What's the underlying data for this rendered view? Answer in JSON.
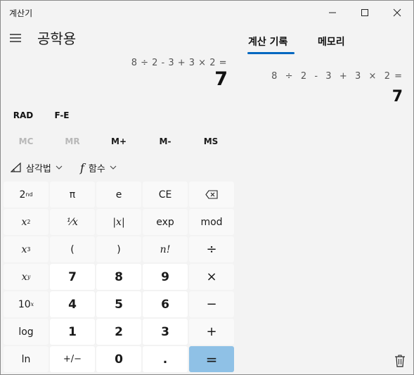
{
  "window": {
    "title": "계산기"
  },
  "header": {
    "mode_title": "공학용"
  },
  "display": {
    "expression": "8 ÷ 2 - 3 + 3 × 2 =",
    "result": "7"
  },
  "modes": {
    "angle": "RAD",
    "fe": "F-E"
  },
  "memory": {
    "mc": "MC",
    "mr": "MR",
    "mplus": "M+",
    "mminus": "M-",
    "ms": "MS"
  },
  "dropdowns": {
    "trig": "삼각법",
    "func_symbol": "f",
    "func": "함수"
  },
  "keypad": {
    "second": "2",
    "second_sup": "nd",
    "pi": "π",
    "e": "e",
    "ce": "CE",
    "x": "x",
    "sq_sup": "2",
    "reciprocal": "⅟x",
    "abs": "|x|",
    "exp": "exp",
    "mod": "mod",
    "cube_sup": "3",
    "lparen": "(",
    "rparen": ")",
    "fact": "n!",
    "divide": "÷",
    "pow_sup": "y",
    "n7": "7",
    "n8": "8",
    "n9": "9",
    "multiply": "×",
    "ten": "10",
    "ten_sup": "x",
    "n4": "4",
    "n5": "5",
    "n6": "6",
    "minus": "−",
    "log": "log",
    "n1": "1",
    "n2": "2",
    "n3": "3",
    "plus": "+",
    "ln": "ln",
    "negate": "+/−",
    "n0": "0",
    "dot": ".",
    "equals": "="
  },
  "panel": {
    "tab_history": "계산 기록",
    "tab_memory": "메모리",
    "history": [
      {
        "expression": "8  ÷  2  -  3  +  3  ×  2 =",
        "result": "7"
      }
    ]
  },
  "colors": {
    "accent": "#0067c0",
    "equals_key": "#8fc1e6"
  },
  "icons": [
    "hamburger-icon",
    "minimize-icon",
    "maximize-icon",
    "close-icon",
    "backspace-icon",
    "trig-icon",
    "chevron-down-icon",
    "trash-icon"
  ]
}
